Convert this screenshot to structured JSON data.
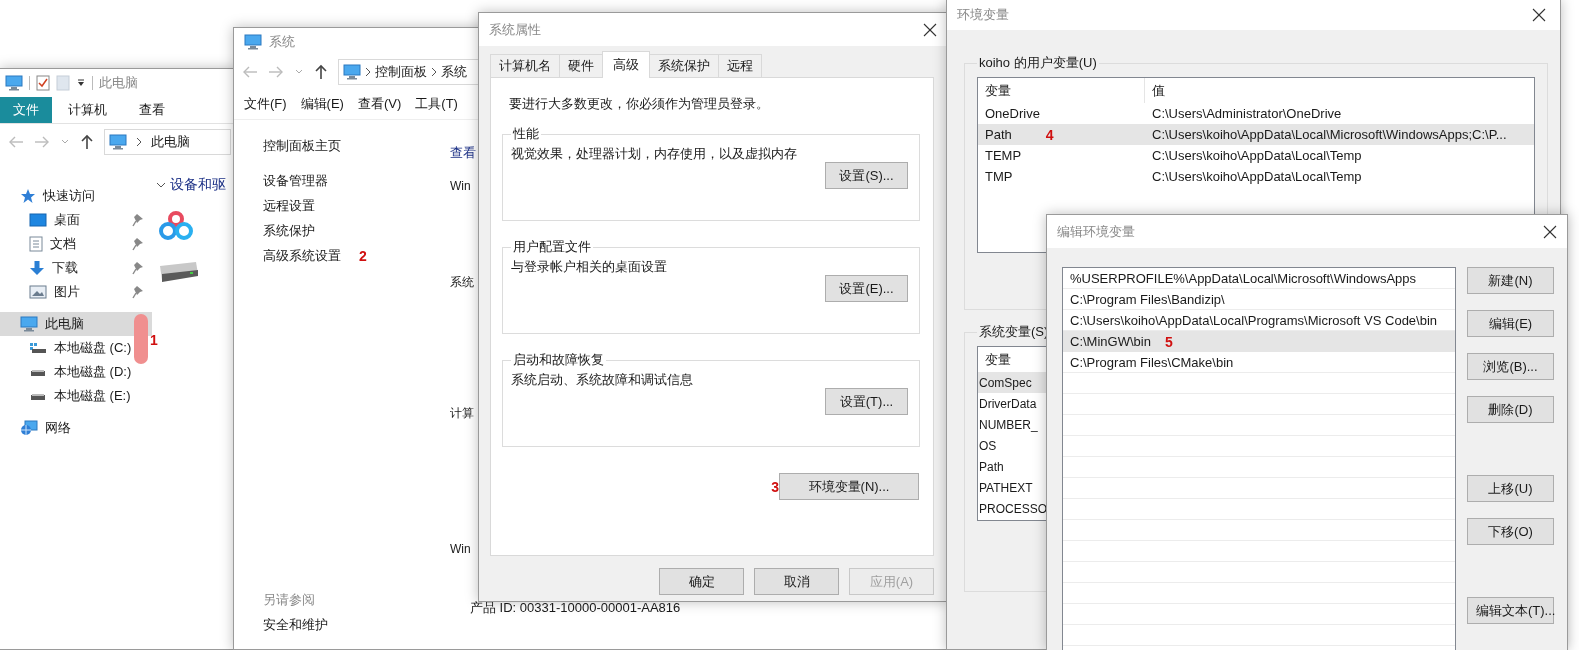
{
  "explorer": {
    "toolbar_title": "此电脑",
    "ribbon_tabs": [
      {
        "label": "文件",
        "selected": true
      },
      {
        "label": "计算机",
        "selected": false
      },
      {
        "label": "查看",
        "selected": false
      }
    ],
    "address": "此电脑",
    "nav": [
      {
        "label": "快速访问",
        "kind": "star",
        "selected": false,
        "pinned": false,
        "children": [
          {
            "label": "桌面",
            "kind": "desktop",
            "selected": false,
            "pinned": true
          },
          {
            "label": "文档",
            "kind": "document",
            "selected": false,
            "pinned": true
          },
          {
            "label": "下载",
            "kind": "download",
            "selected": false,
            "pinned": true
          },
          {
            "label": "图片",
            "kind": "pictures",
            "selected": false,
            "pinned": true
          }
        ]
      },
      {
        "label": "此电脑",
        "kind": "computer",
        "selected": true,
        "pinned": false,
        "children": [
          {
            "label": "本地磁盘 (C:)",
            "kind": "system-drive",
            "selected": false,
            "pinned": false
          },
          {
            "label": "本地磁盘 (D:)",
            "kind": "drive",
            "selected": false,
            "pinned": false
          },
          {
            "label": "本地磁盘 (E:)",
            "kind": "drive",
            "selected": false,
            "pinned": false
          }
        ]
      },
      {
        "label": "网络",
        "kind": "network",
        "selected": false,
        "pinned": false
      }
    ],
    "annotation": "1",
    "section": "设备和驱"
  },
  "system": {
    "title": "系统",
    "breadcrumb": [
      "控制面板",
      "系统"
    ],
    "menu": [
      "文件(F)",
      "编辑(E)",
      "查看(V)",
      "工具(T)"
    ],
    "home_link": "控制面板主页",
    "tasks": [
      {
        "label": "设备管理器"
      },
      {
        "label": "远程设置"
      },
      {
        "label": "系统保护"
      },
      {
        "label": "高级系统设置",
        "annotation": "2"
      }
    ],
    "see_also_title": "另请参阅",
    "see_also": [
      "安全和维护"
    ],
    "main_headings": [
      "查看",
      "Win",
      "系统",
      "计算",
      "Win"
    ],
    "product_id": "产品 ID: 00331-10000-00001-AA816"
  },
  "sysprops": {
    "title": "系统属性",
    "tabs": [
      {
        "label": "计算机名",
        "selected": false
      },
      {
        "label": "硬件",
        "selected": false
      },
      {
        "label": "高级",
        "selected": true
      },
      {
        "label": "系统保护",
        "selected": false
      },
      {
        "label": "远程",
        "selected": false
      }
    ],
    "notice": "要进行大多数更改，你必须作为管理员登录。",
    "groups": [
      {
        "title": "性能",
        "description": "视觉效果，处理器计划，内存使用，以及虚拟内存",
        "button": "设置(S)..."
      },
      {
        "title": "用户配置文件",
        "description": "与登录帐户相关的桌面设置",
        "button": "设置(E)..."
      },
      {
        "title": "启动和故障恢复",
        "description": "系统启动、系统故障和调试信息",
        "button": "设置(T)..."
      }
    ],
    "env_button": "环境变量(N)...",
    "env_annotation": "3",
    "footer": [
      {
        "label": "确定",
        "disabled": false
      },
      {
        "label": "取消",
        "disabled": false
      },
      {
        "label": "应用(A)",
        "disabled": true
      }
    ]
  },
  "env": {
    "title": "环境变量",
    "user_group": "koiho 的用户变量(U)",
    "user_columns": [
      "变量",
      "值"
    ],
    "user_rows": [
      {
        "name": "OneDrive",
        "value": "C:\\Users\\Administrator\\OneDrive",
        "selected": false
      },
      {
        "name": "Path",
        "value": "C:\\Users\\koiho\\AppData\\Local\\Microsoft\\WindowsApps;C:\\P...",
        "selected": true,
        "annotation": "4"
      },
      {
        "name": "TEMP",
        "value": "C:\\Users\\koiho\\AppData\\Local\\Temp",
        "selected": false
      },
      {
        "name": "TMP",
        "value": "C:\\Users\\koiho\\AppData\\Local\\Temp",
        "selected": false
      }
    ],
    "system_group": "系统变量(S)",
    "system_columns": [
      "变量"
    ],
    "system_rows": [
      {
        "name": "ComSpec",
        "selected": true
      },
      {
        "name": "DriverData",
        "selected": false
      },
      {
        "name": "NUMBER_",
        "selected": false
      },
      {
        "name": "OS",
        "selected": false
      },
      {
        "name": "Path",
        "selected": false
      },
      {
        "name": "PATHEXT",
        "selected": false
      },
      {
        "name": "PROCESSO",
        "selected": false
      }
    ]
  },
  "edit": {
    "title": "编辑环境变量",
    "entries": [
      {
        "text": "%USERPROFILE%\\AppData\\Local\\Microsoft\\WindowsApps",
        "selected": false
      },
      {
        "text": "C:\\Program Files\\Bandizip\\",
        "selected": false
      },
      {
        "text": "C:\\Users\\koiho\\AppData\\Local\\Programs\\Microsoft VS Code\\bin",
        "selected": false
      },
      {
        "text": "C:\\MinGW\\bin",
        "selected": true,
        "annotation": "5"
      },
      {
        "text": "C:\\Program Files\\CMake\\bin",
        "selected": false
      }
    ],
    "buttons": [
      "新建(N)",
      "编辑(E)",
      "浏览(B)...",
      "删除(D)",
      "上移(U)",
      "下移(O)",
      "编辑文本(T)..."
    ]
  }
}
